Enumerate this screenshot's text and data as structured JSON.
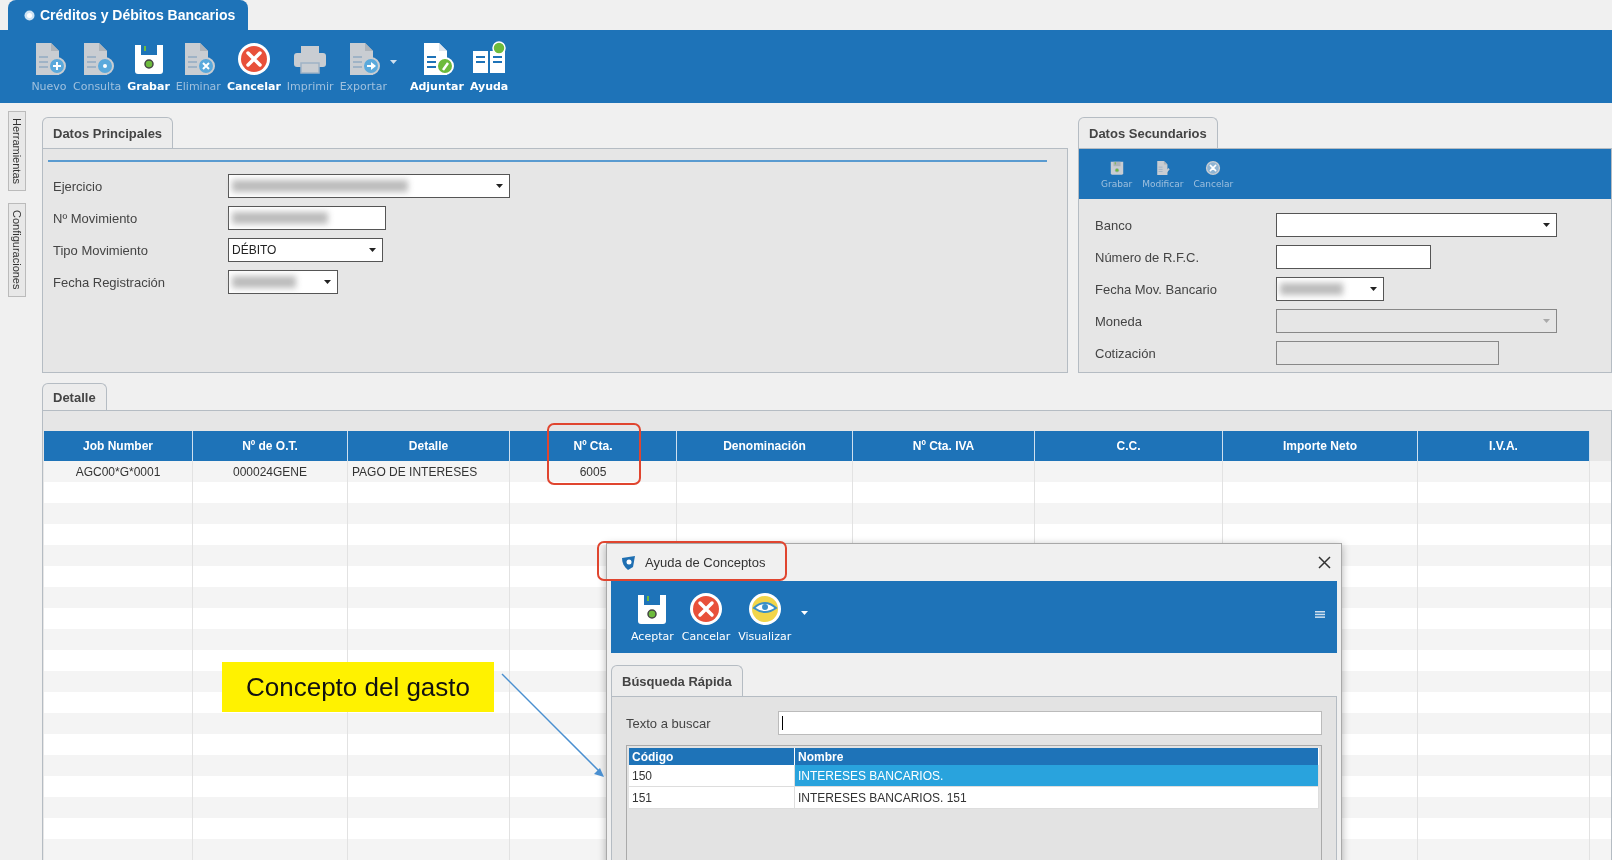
{
  "window_tab": {
    "title": "Créditos y Débitos Bancarios",
    "selected": true
  },
  "toolbar": [
    {
      "kind": "new",
      "label": "Nuevo",
      "disabled": true
    },
    {
      "kind": "query",
      "label": "Consulta",
      "disabled": true
    },
    {
      "kind": "save",
      "label": "Grabar",
      "disabled": false
    },
    {
      "kind": "delete",
      "label": "Eliminar",
      "disabled": true
    },
    {
      "kind": "cancel",
      "label": "Cancelar",
      "disabled": false
    },
    {
      "kind": "print",
      "label": "Imprimir",
      "disabled": true
    },
    {
      "kind": "export",
      "label": "Exportar",
      "disabled": true
    },
    {
      "kind": "attach",
      "label": "Adjuntar",
      "disabled": false
    },
    {
      "kind": "help",
      "label": "Ayuda",
      "disabled": false
    }
  ],
  "side_tabs": [
    {
      "label": "Herramientas"
    },
    {
      "label": "Configuraciones"
    }
  ],
  "main_panel": {
    "tab": "Datos Principales",
    "fields": [
      {
        "label": "Ejercicio",
        "kind": "combo",
        "redacted": true
      },
      {
        "label": "Nº Movimiento",
        "kind": "input",
        "redacted": true
      },
      {
        "label": "Tipo Movimiento",
        "kind": "combo",
        "value": "DÉBITO"
      },
      {
        "label": "Fecha Registración",
        "kind": "date",
        "redacted": true
      }
    ]
  },
  "secondary_panel": {
    "tab": "Datos Secundarios",
    "toolbar": [
      {
        "kind": "save",
        "label": "Grabar",
        "disabled": true
      },
      {
        "kind": "edit",
        "label": "Modificar",
        "disabled": true
      },
      {
        "kind": "cancel",
        "label": "Cancelar",
        "disabled": true
      }
    ],
    "fields": [
      {
        "label": "Banco",
        "kind": "combo"
      },
      {
        "label": "Número de R.F.C.",
        "kind": "input"
      },
      {
        "label": "Fecha Mov. Bancario",
        "kind": "combo",
        "redacted": true
      },
      {
        "label": "Moneda",
        "kind": "combo",
        "disabled": true
      },
      {
        "label": "Cotización",
        "kind": "input",
        "disabled": true
      }
    ]
  },
  "detail": {
    "tab": "Detalle",
    "table": {
      "columns": [
        {
          "label": "Job Number",
          "highlighted": false
        },
        {
          "label": "Nº de O.T.",
          "highlighted": false
        },
        {
          "label": "Detalle",
          "highlighted": false
        },
        {
          "label": "Nº Cta.",
          "highlighted": true
        },
        {
          "label": "Denominación",
          "highlighted": false
        },
        {
          "label": "Nº  Cta. IVA",
          "highlighted": false
        },
        {
          "label": "C.C.",
          "highlighted": false
        },
        {
          "label": "Importe Neto",
          "highlighted": false
        },
        {
          "label": "I.V.A.",
          "highlighted": false
        }
      ],
      "rows": [
        {
          "cells": [
            "AGC00*G*0001",
            "000024GENE",
            "PAGO DE INTERESES",
            "6005"
          ]
        }
      ]
    }
  },
  "dialog": {
    "title": "Ayuda de Conceptos",
    "highlighted": true,
    "toolbar": [
      {
        "kind": "accept",
        "label": "Aceptar"
      },
      {
        "kind": "cancel",
        "label": "Cancelar"
      },
      {
        "kind": "view",
        "label": "Visualizar"
      }
    ],
    "tab": "Búsqueda Rápida",
    "search": {
      "label": "Texto a buscar",
      "focused": true
    },
    "table": {
      "columns": [
        "Código",
        "Nombre"
      ],
      "rows": [
        {
          "cells": [
            "150",
            "INTERESES BANCARIOS."
          ],
          "selected": true
        },
        {
          "cells": [
            "151",
            "INTERESES BANCARIOS. 151"
          ],
          "selected": false
        }
      ]
    }
  },
  "callout": {
    "text": "Concepto del gasto"
  }
}
